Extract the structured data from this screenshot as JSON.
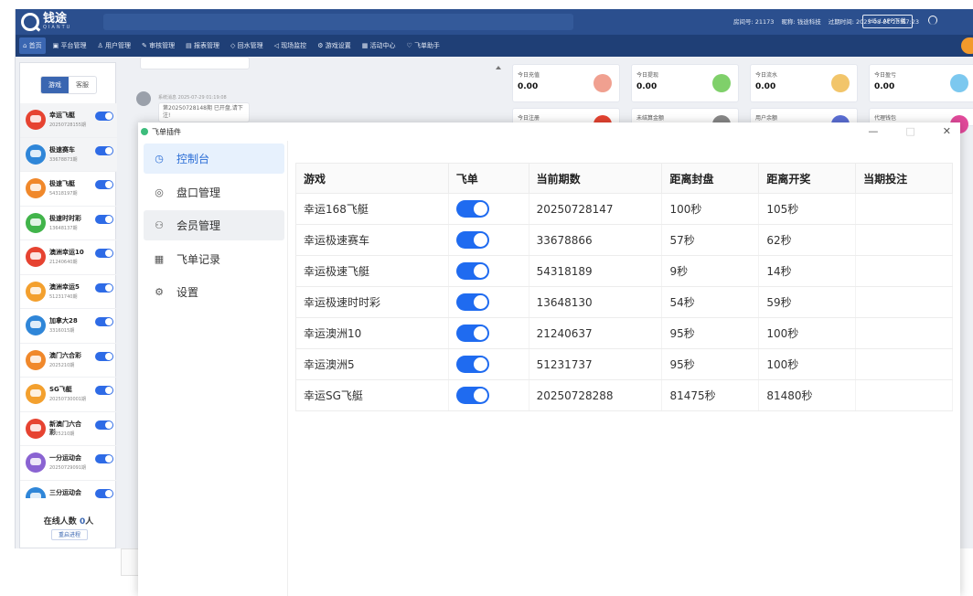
{
  "topbar": {
    "brand": "钱途",
    "brand_sub": "QIANTU",
    "room_no": "房间号: 21173",
    "nickname": "昵称: 钱途科技",
    "expire": "过期时间: 2025-08-21 23:57:23",
    "download_button": "H5 / APP下载"
  },
  "nav": {
    "items": [
      {
        "label": "首页",
        "icon": "home-icon"
      },
      {
        "label": "平台管理",
        "icon": "platform-icon"
      },
      {
        "label": "用户管理",
        "icon": "user-icon"
      },
      {
        "label": "审核管理",
        "icon": "audit-icon"
      },
      {
        "label": "报表管理",
        "icon": "report-icon"
      },
      {
        "label": "回水管理",
        "icon": "rebate-icon"
      },
      {
        "label": "现场监控",
        "icon": "monitor-icon"
      },
      {
        "label": "游戏设置",
        "icon": "gear-icon"
      },
      {
        "label": "活动中心",
        "icon": "event-icon"
      },
      {
        "label": "飞单助手",
        "icon": "heart-icon"
      }
    ]
  },
  "left_panel": {
    "tabs": [
      "游戏",
      "客服"
    ],
    "games": [
      {
        "name": "幸运飞艇",
        "code": "20250728155期",
        "color": "#e64331"
      },
      {
        "name": "极速赛车",
        "code": "33678873期",
        "color": "#2f86d8"
      },
      {
        "name": "极速飞艇",
        "code": "54318197期",
        "color": "#f0882b"
      },
      {
        "name": "极速时时彩",
        "code": "13648137期",
        "color": "#41b44a"
      },
      {
        "name": "澳洲幸运10",
        "code": "21240640期",
        "color": "#e64331"
      },
      {
        "name": "澳洲幸运5",
        "code": "51231740期",
        "color": "#f3a02e"
      },
      {
        "name": "加拿大28",
        "code": "3316015期",
        "color": "#2f86d8"
      },
      {
        "name": "澳门六合彩",
        "code": "2025210期",
        "color": "#f0882b"
      },
      {
        "name": "SG飞艇",
        "code": "20250730001期",
        "color": "#f3a02e"
      },
      {
        "name": "新澳门六合彩",
        "code": "2025210期",
        "color": "#e64331"
      },
      {
        "name": "一分运动会",
        "code": "20250729091期",
        "color": "#8a63d2"
      },
      {
        "name": "三分运动会",
        "code": "",
        "color": "#2f86d8"
      }
    ],
    "online_label": "在线人数",
    "online_count": "0",
    "online_unit": "人",
    "restart_button": "重启进程"
  },
  "chat": {
    "meta": "系统消息 2025-07-29 01:19:08",
    "message": "第20250728148期 已开盘,请下注!"
  },
  "stats": [
    {
      "label": "今日充值",
      "value": "0.00",
      "color": "#f0a090"
    },
    {
      "label": "今日提现",
      "value": "0.00",
      "color": "#7fd06a"
    },
    {
      "label": "今日流水",
      "value": "0.00",
      "color": "#f2c56a"
    },
    {
      "label": "今日盈亏",
      "value": "0.00",
      "color": "#7cc8ef"
    }
  ],
  "stats2": [
    {
      "label": "今日注册",
      "color": "#e64331"
    },
    {
      "label": "未结算金额",
      "color": "#888888"
    },
    {
      "label": "用户余额",
      "color": "#5b6fd6"
    },
    {
      "label": "代理钱包",
      "color": "#e24a9b"
    }
  ],
  "plugin": {
    "title": "飞单插件",
    "window_controls": [
      "—",
      "□",
      "✕"
    ],
    "menu": [
      {
        "label": "控制台",
        "icon": "◷"
      },
      {
        "label": "盘口管理",
        "icon": "◎"
      },
      {
        "label": "会员管理",
        "icon": "⚇"
      },
      {
        "label": "飞单记录",
        "icon": "▦"
      },
      {
        "label": "设置",
        "icon": "⚙"
      }
    ],
    "table": {
      "headers": [
        "游戏",
        "飞单",
        "当前期数",
        "距离封盘",
        "距离开奖",
        "当期投注"
      ],
      "rows": [
        {
          "game": "幸运168飞艇",
          "period": "20250728147",
          "close": "100秒",
          "draw": "105秒",
          "bet": ""
        },
        {
          "game": "幸运极速赛车",
          "period": "33678866",
          "close": "57秒",
          "draw": "62秒",
          "bet": ""
        },
        {
          "game": "幸运极速飞艇",
          "period": "54318189",
          "close": "9秒",
          "draw": "14秒",
          "bet": ""
        },
        {
          "game": "幸运极速时时彩",
          "period": "13648130",
          "close": "54秒",
          "draw": "59秒",
          "bet": ""
        },
        {
          "game": "幸运澳洲10",
          "period": "21240637",
          "close": "95秒",
          "draw": "100秒",
          "bet": ""
        },
        {
          "game": "幸运澳洲5",
          "period": "51231737",
          "close": "95秒",
          "draw": "100秒",
          "bet": ""
        },
        {
          "game": "幸运SG飞艇",
          "period": "20250728288",
          "close": "81475秒",
          "draw": "81480秒",
          "bet": ""
        }
      ]
    }
  }
}
